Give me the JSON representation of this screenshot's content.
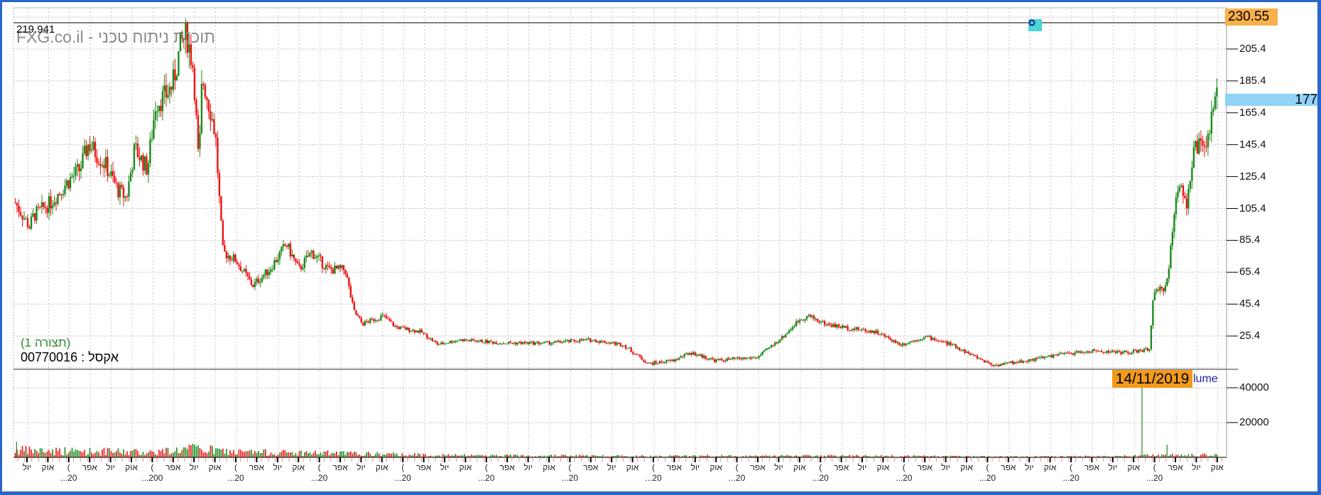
{
  "header": {
    "title": "FXG.co.il - תוכנת ניתוח טכני",
    "last_line_value": "219.941",
    "high_label": "230.55",
    "current_price_label": "177",
    "configuration": "(תצורה 1)",
    "symbol": "אקסל : 00770016",
    "cursor_date": "14/11/2019",
    "volume_label": "lume"
  },
  "colors": {
    "up": "#1a8a1a",
    "down": "#ee1111",
    "border": "#2a66c8",
    "high": "#f7b04a",
    "current": "#8fd3f7",
    "date": "#f39a1a"
  },
  "chart_data": [
    {
      "type": "candlestick",
      "title": "FXG.co.il - תוכנת ניתוח טכני",
      "ylabel": "",
      "y_ticks": [
        "205.4",
        "185.4",
        "165.4",
        "145.4",
        "125.4",
        "105.4",
        "85.4",
        "65.4",
        "45.4",
        "25.4"
      ],
      "ylim": [
        1,
        232
      ],
      "x_unit": "quarters from first tick",
      "grid": true,
      "price_path": [
        [
          -0.56,
          109
        ],
        [
          0.12,
          94
        ],
        [
          0.32,
          101
        ],
        [
          1.13,
          109
        ],
        [
          1.94,
          122
        ],
        [
          2.54,
          130
        ],
        [
          2.94,
          146
        ],
        [
          3.75,
          133
        ],
        [
          4.35,
          117
        ],
        [
          4.76,
          112
        ],
        [
          5.16,
          143
        ],
        [
          5.77,
          130
        ],
        [
          6.17,
          172
        ],
        [
          6.57,
          175
        ],
        [
          6.98,
          183
        ],
        [
          7.38,
          209
        ],
        [
          7.66,
          214
        ],
        [
          7.98,
          193
        ],
        [
          8.23,
          130
        ],
        [
          8.39,
          188
        ],
        [
          8.79,
          167
        ],
        [
          9.03,
          151
        ],
        [
          9.27,
          99
        ],
        [
          9.39,
          78
        ],
        [
          10.0,
          73
        ],
        [
          10.81,
          57
        ],
        [
          11.61,
          67
        ],
        [
          12.42,
          83
        ],
        [
          13.02,
          67
        ],
        [
          13.63,
          78
        ],
        [
          14.44,
          67
        ],
        [
          15.24,
          67
        ],
        [
          15.65,
          41
        ],
        [
          16.05,
          33
        ],
        [
          17.06,
          38
        ],
        [
          17.66,
          31
        ],
        [
          18.87,
          28
        ],
        [
          19.68,
          20
        ],
        [
          20.69,
          23
        ],
        [
          22.9,
          21
        ],
        [
          24.92,
          21
        ],
        [
          26.94,
          23
        ],
        [
          28.55,
          20
        ],
        [
          29.76,
          8
        ],
        [
          30.97,
          10
        ],
        [
          31.77,
          15
        ],
        [
          32.98,
          10
        ],
        [
          34.99,
          12
        ],
        [
          36.21,
          25
        ],
        [
          37.02,
          36
        ],
        [
          37.42,
          38
        ],
        [
          38.23,
          33
        ],
        [
          39.03,
          31
        ],
        [
          40.65,
          28
        ],
        [
          41.85,
          20
        ],
        [
          43.06,
          25
        ],
        [
          44.27,
          20
        ],
        [
          45.48,
          12
        ],
        [
          46.29,
          7
        ],
        [
          47.9,
          10
        ],
        [
          49.52,
          14
        ],
        [
          51.13,
          16
        ],
        [
          52.74,
          15
        ],
        [
          53.75,
          17
        ],
        [
          53.95,
          51
        ],
        [
          54.56,
          57
        ],
        [
          54.76,
          78
        ],
        [
          55.16,
          125
        ],
        [
          55.56,
          109
        ],
        [
          55.97,
          146
        ],
        [
          56.37,
          141
        ],
        [
          56.77,
          162
        ],
        [
          57.02,
          177
        ]
      ],
      "last_line": 219.941,
      "high": 230.55,
      "current": 177
    },
    {
      "type": "bar",
      "title": "Volume",
      "y_ticks": [
        "40000",
        "20000"
      ],
      "ylim": [
        0,
        50000
      ],
      "volume_level": [
        [
          -0.56,
          4000
        ],
        [
          6,
          3000
        ],
        [
          8,
          5000
        ],
        [
          10,
          3000
        ],
        [
          14,
          2500
        ],
        [
          20,
          1200
        ],
        [
          30,
          800
        ],
        [
          40,
          900
        ],
        [
          47,
          500
        ],
        [
          52,
          700
        ],
        [
          56,
          1500
        ],
        [
          57,
          1200
        ]
      ],
      "spikes": [
        [
          -0.5,
          9000
        ],
        [
          53.4,
          50000
        ],
        [
          54.6,
          7300
        ]
      ]
    }
  ],
  "x_axis": {
    "month_labels": [
      "יול",
      "אוק",
      "(",
      "אפר",
      "יול",
      "אוק",
      "(",
      "אפר",
      "יול",
      "אוק",
      "(",
      "אפר",
      "יול",
      "אוק",
      "(",
      "אפר",
      "יול",
      "אוק",
      "(",
      "אפר",
      "יול",
      "אוק",
      "(",
      "אפר",
      "יול",
      "אוק",
      "(",
      "אפר",
      "יול",
      "אוק",
      "(",
      "אפר",
      "יול",
      "אוק",
      "(",
      "אפר",
      "יול",
      "אוק",
      "(",
      "אפר",
      "יול",
      "אוק",
      "(",
      "אפר",
      "יול",
      "אוק",
      "(",
      "אפר",
      "יול",
      "אוק",
      "(",
      "אפר",
      "יול",
      "אוק",
      "(",
      "אפר",
      "יול",
      "אוק"
    ],
    "year_labels": [
      "...20",
      "...200",
      "...20",
      "...20",
      "...20",
      "...20",
      "...20",
      "...20",
      "...20",
      "...20",
      "...20",
      "...20",
      "...20",
      "...20"
    ]
  }
}
